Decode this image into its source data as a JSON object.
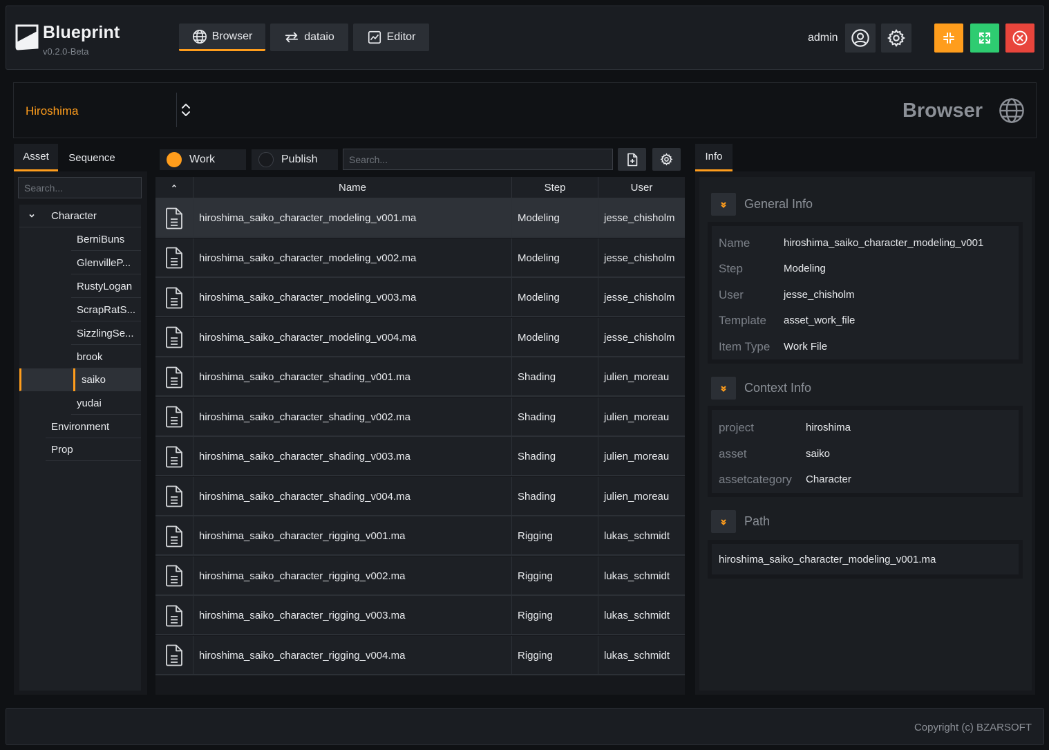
{
  "app": {
    "title": "Blueprint",
    "version": "v0.2.0-Beta",
    "nav_tabs": [
      {
        "label": "Browser",
        "icon": "globe-icon",
        "active": true
      },
      {
        "label": "dataio",
        "icon": "swap-arrows-icon",
        "active": false
      },
      {
        "label": "Editor",
        "icon": "chart-window-icon",
        "active": false
      }
    ],
    "user": "admin",
    "accent_color": "#ff9d1c"
  },
  "project": {
    "name": "Hiroshima",
    "page_title": "Browser"
  },
  "left_panel": {
    "tabs": [
      "Asset",
      "Sequence"
    ],
    "search_placeholder": "Search...",
    "tree": [
      {
        "label": "Character",
        "expanded": true,
        "children": [
          "BerniBuns",
          "GlenvilleP...",
          "RustyLogan",
          "ScrapRatS...",
          "SizzlingSe...",
          "brook",
          "saiko",
          "yudai"
        ]
      },
      {
        "label": "Environment"
      },
      {
        "label": "Prop"
      }
    ],
    "selected": "saiko"
  },
  "toolbar": {
    "work_label": "Work",
    "publish_label": "Publish",
    "search_placeholder": "Search..."
  },
  "table": {
    "columns": [
      "Name",
      "Step",
      "User"
    ],
    "rows": [
      {
        "name": "hiroshima_saiko_character_modeling_v001.ma",
        "step": "Modeling",
        "user": "jesse_chisholm"
      },
      {
        "name": "hiroshima_saiko_character_modeling_v002.ma",
        "step": "Modeling",
        "user": "jesse_chisholm"
      },
      {
        "name": "hiroshima_saiko_character_modeling_v003.ma",
        "step": "Modeling",
        "user": "jesse_chisholm"
      },
      {
        "name": "hiroshima_saiko_character_modeling_v004.ma",
        "step": "Modeling",
        "user": "jesse_chisholm"
      },
      {
        "name": "hiroshima_saiko_character_shading_v001.ma",
        "step": "Shading",
        "user": "julien_moreau"
      },
      {
        "name": "hiroshima_saiko_character_shading_v002.ma",
        "step": "Shading",
        "user": "julien_moreau"
      },
      {
        "name": "hiroshima_saiko_character_shading_v003.ma",
        "step": "Shading",
        "user": "julien_moreau"
      },
      {
        "name": "hiroshima_saiko_character_shading_v004.ma",
        "step": "Shading",
        "user": "julien_moreau"
      },
      {
        "name": "hiroshima_saiko_character_rigging_v001.ma",
        "step": "Rigging",
        "user": "lukas_schmidt"
      },
      {
        "name": "hiroshima_saiko_character_rigging_v002.ma",
        "step": "Rigging",
        "user": "lukas_schmidt"
      },
      {
        "name": "hiroshima_saiko_character_rigging_v003.ma",
        "step": "Rigging",
        "user": "lukas_schmidt"
      },
      {
        "name": "hiroshima_saiko_character_rigging_v004.ma",
        "step": "Rigging",
        "user": "lukas_schmidt"
      }
    ]
  },
  "info": {
    "tab_label": "Info",
    "general": {
      "title": "General Info",
      "items": [
        {
          "key": "Name",
          "value": "hiroshima_saiko_character_modeling_v001"
        },
        {
          "key": "Step",
          "value": "Modeling"
        },
        {
          "key": "User",
          "value": "jesse_chisholm"
        },
        {
          "key": "Template",
          "value": "asset_work_file"
        },
        {
          "key": "Item Type",
          "value": "Work File"
        }
      ]
    },
    "context": {
      "title": "Context Info",
      "items": [
        {
          "key": "project",
          "value": "hiroshima"
        },
        {
          "key": "asset",
          "value": "saiko"
        },
        {
          "key": "assetcategory",
          "value": "Character"
        }
      ]
    },
    "path": {
      "title": "Path",
      "value": "hiroshima_saiko_character_modeling_v001.ma"
    }
  },
  "footer": {
    "copyright": "Copyright (c) BZARSOFT"
  }
}
